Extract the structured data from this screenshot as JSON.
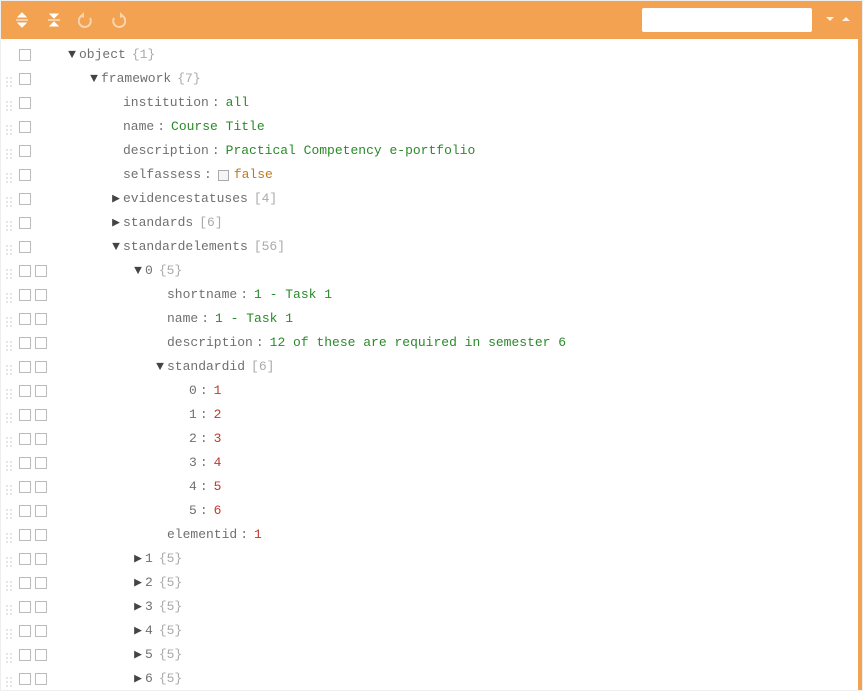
{
  "toolbar": {
    "search_placeholder": ""
  },
  "tree": {
    "root": {
      "key": "object",
      "meta": "{1}"
    },
    "framework": {
      "key": "framework",
      "meta": "{7}",
      "institution": {
        "key": "institution",
        "value": "all"
      },
      "name": {
        "key": "name",
        "value": "Course Title"
      },
      "description": {
        "key": "description",
        "value": "Practical Competency e-portfolio"
      },
      "selfassess": {
        "key": "selfassess",
        "value": "false"
      },
      "evidencestatuses": {
        "key": "evidencestatuses",
        "meta": "[4]"
      },
      "standards": {
        "key": "standards",
        "meta": "[6]"
      },
      "standardelements": {
        "key": "standardelements",
        "meta": "[56]",
        "item0": {
          "key": "0",
          "meta": "{5}",
          "shortname": {
            "key": "shortname",
            "value": "1 - Task 1"
          },
          "name": {
            "key": "name",
            "value": "1 - Task 1"
          },
          "description": {
            "key": "description",
            "value": "12 of these are required in semester 6"
          },
          "standardid": {
            "key": "standardid",
            "meta": "[6]",
            "items": [
              {
                "key": "0",
                "value": "1"
              },
              {
                "key": "1",
                "value": "2"
              },
              {
                "key": "2",
                "value": "3"
              },
              {
                "key": "3",
                "value": "4"
              },
              {
                "key": "4",
                "value": "5"
              },
              {
                "key": "5",
                "value": "6"
              }
            ]
          },
          "elementid": {
            "key": "elementid",
            "value": "1"
          }
        },
        "remaining": [
          {
            "key": "1",
            "meta": "{5}"
          },
          {
            "key": "2",
            "meta": "{5}"
          },
          {
            "key": "3",
            "meta": "{5}"
          },
          {
            "key": "4",
            "meta": "{5}"
          },
          {
            "key": "5",
            "meta": "{5}"
          },
          {
            "key": "6",
            "meta": "{5}"
          }
        ]
      }
    }
  },
  "chart_data": {
    "type": "table",
    "title": "JSON tree view",
    "root_object": {
      "framework": {
        "institution": "all",
        "name": "Course Title",
        "description": "Practical Competency e-portfolio",
        "selfassess": false,
        "evidencestatuses_length": 4,
        "standards_length": 6,
        "standardelements_length": 56,
        "standardelements_0": {
          "shortname": "1 - Task 1",
          "name": "1 - Task 1",
          "description": "12 of these are required in semester 6",
          "standardid": [
            1,
            2,
            3,
            4,
            5,
            6
          ],
          "elementid": 1
        },
        "standardelements_1_to_6_child_count": 5
      }
    }
  }
}
